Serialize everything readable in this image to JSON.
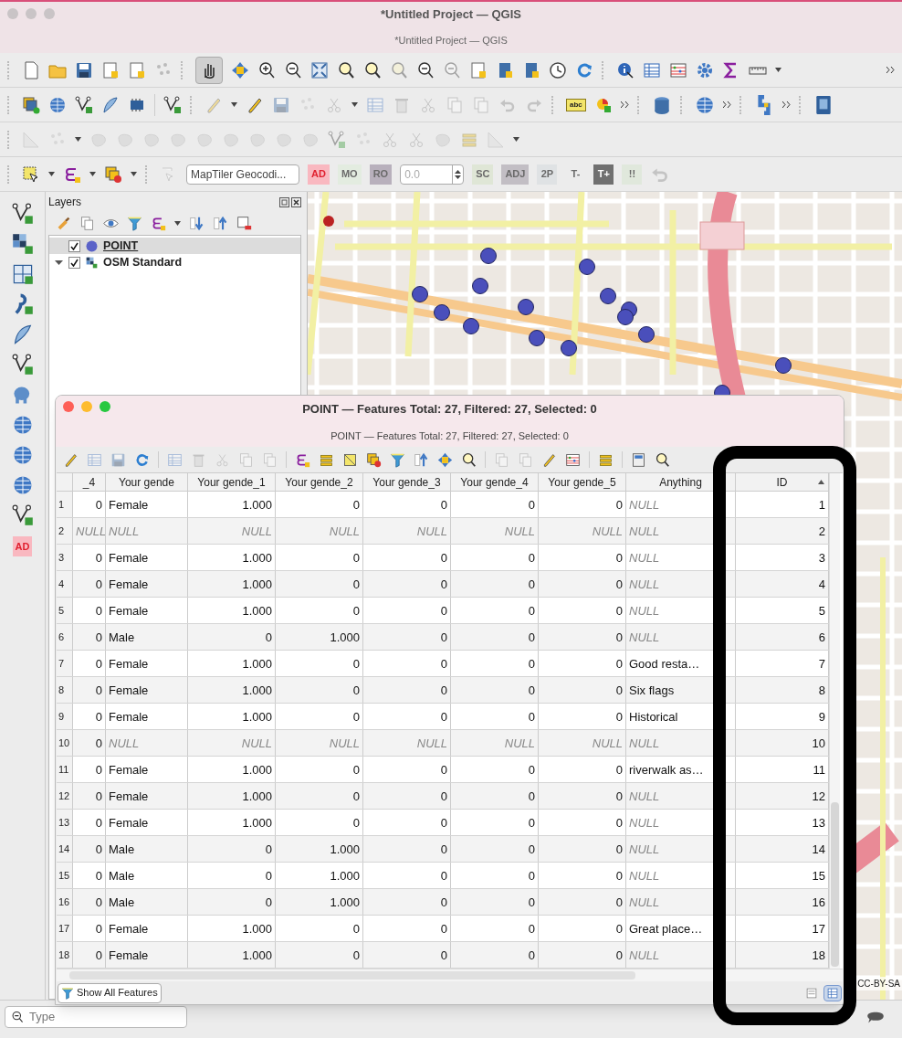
{
  "window": {
    "title": "*Untitled Project — QGIS",
    "subtitle": "*Untitled Project — QGIS"
  },
  "toolbar": {
    "label_tool_text": "abc",
    "geocoder": {
      "value": "MapTiler Geocodi..."
    },
    "spin": {
      "value": "0.0",
      "disabled": true
    },
    "buttons": [
      {
        "label": "AD",
        "color": "#f9b8c0",
        "disabled": false
      },
      {
        "label": "MO",
        "color": "#e3ece0",
        "disabled": true
      },
      {
        "label": "RO",
        "color": "#b8b0bc",
        "disabled": true
      },
      {
        "label": "SC",
        "color": "#dfe6d6",
        "disabled": true
      },
      {
        "label": "ADJ",
        "color": "#c2bec4",
        "disabled": true
      },
      {
        "label": "2P",
        "color": "#dfe2e4",
        "disabled": true
      },
      {
        "label": "T-",
        "color": "#ececec",
        "disabled": true
      },
      {
        "label": "T+",
        "color": "#707070",
        "disabled": false
      },
      {
        "label": "!!",
        "color": "#e0e8dc",
        "disabled": true
      }
    ]
  },
  "side_toolbar": {
    "button": {
      "label": "AD",
      "color": "#f9b8c0"
    }
  },
  "layers_panel": {
    "title": "Layers",
    "layers": [
      {
        "name": "POINT",
        "kind": "point",
        "checked": true,
        "selected": true
      },
      {
        "name": "OSM Standard",
        "kind": "raster",
        "checked": true,
        "selected": false,
        "expanded": true
      }
    ]
  },
  "map": {
    "attribution": "CC-BY-SA"
  },
  "attribute_table": {
    "title": "POINT — Features Total: 27, Filtered: 27, Selected: 0",
    "subtitle": "POINT — Features Total: 27, Filtered: 27, Selected: 0",
    "columns": [
      {
        "label": "_4",
        "kind": "number",
        "sorted": false
      },
      {
        "label": "Your gende",
        "kind": "text",
        "sorted": false
      },
      {
        "label": "Your gende_1",
        "kind": "number",
        "sorted": false
      },
      {
        "label": "Your gende_2",
        "kind": "number",
        "sorted": false
      },
      {
        "label": "Your gende_3",
        "kind": "number",
        "sorted": false
      },
      {
        "label": "Your gende_4",
        "kind": "number",
        "sorted": false
      },
      {
        "label": "Your gende_5",
        "kind": "number",
        "sorted": false
      },
      {
        "label": "Anything",
        "kind": "text",
        "sorted": false
      },
      {
        "label": "ID",
        "kind": "number",
        "sorted": true
      }
    ],
    "rows": [
      {
        "n": "1",
        "cells": [
          "0",
          "Female",
          "1.000",
          "0",
          "0",
          "0",
          "0",
          "NULL",
          "1"
        ],
        "null": [
          false,
          false,
          false,
          false,
          false,
          false,
          false,
          true,
          false
        ]
      },
      {
        "n": "2",
        "cells": [
          "NULL",
          "NULL",
          "NULL",
          "NULL",
          "NULL",
          "NULL",
          "NULL",
          "NULL",
          "2"
        ],
        "null": [
          true,
          true,
          true,
          true,
          true,
          true,
          true,
          true,
          false
        ]
      },
      {
        "n": "3",
        "cells": [
          "0",
          "Female",
          "1.000",
          "0",
          "0",
          "0",
          "0",
          "NULL",
          "3"
        ],
        "null": [
          false,
          false,
          false,
          false,
          false,
          false,
          false,
          true,
          false
        ]
      },
      {
        "n": "4",
        "cells": [
          "0",
          "Female",
          "1.000",
          "0",
          "0",
          "0",
          "0",
          "NULL",
          "4"
        ],
        "null": [
          false,
          false,
          false,
          false,
          false,
          false,
          false,
          true,
          false
        ]
      },
      {
        "n": "5",
        "cells": [
          "0",
          "Female",
          "1.000",
          "0",
          "0",
          "0",
          "0",
          "NULL",
          "5"
        ],
        "null": [
          false,
          false,
          false,
          false,
          false,
          false,
          false,
          true,
          false
        ]
      },
      {
        "n": "6",
        "cells": [
          "0",
          "Male",
          "0",
          "1.000",
          "0",
          "0",
          "0",
          "NULL",
          "6"
        ],
        "null": [
          false,
          false,
          false,
          false,
          false,
          false,
          false,
          true,
          false
        ]
      },
      {
        "n": "7",
        "cells": [
          "0",
          "Female",
          "1.000",
          "0",
          "0",
          "0",
          "0",
          "Good resta…",
          "7"
        ],
        "null": [
          false,
          false,
          false,
          false,
          false,
          false,
          false,
          false,
          false
        ]
      },
      {
        "n": "8",
        "cells": [
          "0",
          "Female",
          "1.000",
          "0",
          "0",
          "0",
          "0",
          "Six flags",
          "8"
        ],
        "null": [
          false,
          false,
          false,
          false,
          false,
          false,
          false,
          false,
          false
        ]
      },
      {
        "n": "9",
        "cells": [
          "0",
          "Female",
          "1.000",
          "0",
          "0",
          "0",
          "0",
          "Historical",
          "9"
        ],
        "null": [
          false,
          false,
          false,
          false,
          false,
          false,
          false,
          false,
          false
        ]
      },
      {
        "n": "10",
        "cells": [
          "0",
          "NULL",
          "NULL",
          "NULL",
          "NULL",
          "NULL",
          "NULL",
          "NULL",
          "10"
        ],
        "null": [
          false,
          true,
          true,
          true,
          true,
          true,
          true,
          true,
          false
        ]
      },
      {
        "n": "11",
        "cells": [
          "0",
          "Female",
          "1.000",
          "0",
          "0",
          "0",
          "0",
          "riverwalk as…",
          "11"
        ],
        "null": [
          false,
          false,
          false,
          false,
          false,
          false,
          false,
          false,
          false
        ]
      },
      {
        "n": "12",
        "cells": [
          "0",
          "Female",
          "1.000",
          "0",
          "0",
          "0",
          "0",
          "NULL",
          "12"
        ],
        "null": [
          false,
          false,
          false,
          false,
          false,
          false,
          false,
          true,
          false
        ]
      },
      {
        "n": "13",
        "cells": [
          "0",
          "Female",
          "1.000",
          "0",
          "0",
          "0",
          "0",
          "NULL",
          "13"
        ],
        "null": [
          false,
          false,
          false,
          false,
          false,
          false,
          false,
          true,
          false
        ]
      },
      {
        "n": "14",
        "cells": [
          "0",
          "Male",
          "0",
          "1.000",
          "0",
          "0",
          "0",
          "NULL",
          "14"
        ],
        "null": [
          false,
          false,
          false,
          false,
          false,
          false,
          false,
          true,
          false
        ]
      },
      {
        "n": "15",
        "cells": [
          "0",
          "Male",
          "0",
          "1.000",
          "0",
          "0",
          "0",
          "NULL",
          "15"
        ],
        "null": [
          false,
          false,
          false,
          false,
          false,
          false,
          false,
          true,
          false
        ]
      },
      {
        "n": "16",
        "cells": [
          "0",
          "Male",
          "0",
          "1.000",
          "0",
          "0",
          "0",
          "NULL",
          "16"
        ],
        "null": [
          false,
          false,
          false,
          false,
          false,
          false,
          false,
          true,
          false
        ]
      },
      {
        "n": "17",
        "cells": [
          "0",
          "Female",
          "1.000",
          "0",
          "0",
          "0",
          "0",
          "Great place…",
          "17"
        ],
        "null": [
          false,
          false,
          false,
          false,
          false,
          false,
          false,
          false,
          false
        ]
      },
      {
        "n": "18",
        "cells": [
          "0",
          "Female",
          "1.000",
          "0",
          "0",
          "0",
          "0",
          "NULL",
          "18"
        ],
        "null": [
          false,
          false,
          false,
          false,
          false,
          false,
          false,
          true,
          false
        ]
      }
    ],
    "filter_button": {
      "label": "Show All Features"
    },
    "view": {
      "form_selected": false,
      "table_selected": true
    }
  },
  "status_bar": {
    "search": {
      "placeholder": "Type"
    }
  }
}
